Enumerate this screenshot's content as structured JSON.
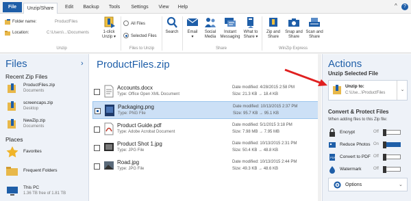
{
  "menubar": {
    "items": [
      "File",
      "Unzip/Share",
      "Edit",
      "Backup",
      "Tools",
      "Settings",
      "View",
      "Help"
    ],
    "collapse": "^",
    "help": "?"
  },
  "ribbon": {
    "unzip": {
      "folder_label": "Folder name:",
      "folder_value": "ProductFiles",
      "location_label": "Location:",
      "location_value": "C:\\Users\\...\\Documents",
      "oneclick": [
        "1-click",
        "Unzip ▾"
      ],
      "group_label": "Unzip"
    },
    "files_to_unzip": {
      "all_files": "All Files",
      "selected_files": "Selected Files",
      "group_label": "Files to Unzip"
    },
    "search": "Search",
    "share": {
      "buttons": [
        [
          "Email",
          "▾"
        ],
        [
          "Social",
          "Media"
        ],
        [
          "Instant",
          "Messaging"
        ],
        [
          "What to",
          "Share ▾"
        ]
      ],
      "group_label": "Share"
    },
    "express": {
      "buttons": [
        [
          "Zip and",
          "Share"
        ],
        [
          "Snap and",
          "Share"
        ],
        [
          "Scan and",
          "Share"
        ]
      ],
      "group_label": "WinZip Express"
    }
  },
  "left": {
    "title": "Files",
    "arrow": "›",
    "recent_title": "Recent Zip Files",
    "recent": [
      {
        "name": "ProductFiles.zip",
        "sub": "Documents"
      },
      {
        "name": "screencaps.zip",
        "sub": "Desktop"
      },
      {
        "name": "NewZip.zip",
        "sub": "Documents"
      }
    ],
    "places_title": "Places",
    "places": [
      {
        "name": "Favorites"
      },
      {
        "name": "Frequent Folders"
      },
      {
        "name": "This PC",
        "sub": "1.36 TB free of 1.81 TB"
      }
    ]
  },
  "main": {
    "title": "ProductFiles.zip",
    "files": [
      {
        "name": "Accounts.docx",
        "type": "Type: Office Open XML Document",
        "date": "Date modified: 4/28/2015 2:58 PM",
        "size": "Size: 21.3 KB  →  18.4 KB",
        "selected": false
      },
      {
        "name": "Packaging.png",
        "type": "Type: PNG File",
        "date": "Date modified: 10/13/2015 2:37 PM",
        "size": "Size: 95.7 KB  →  95.1 KB",
        "selected": true
      },
      {
        "name": "Product Guide.pdf",
        "type": "Type: Adobe Acrobat Document",
        "date": "Date modified: 5/1/2015 3:18 PM",
        "size": "Size: 7.98 MB  →  7.95 MB",
        "selected": false
      },
      {
        "name": "Product Shot 1.jpg",
        "type": "Type: JPG File",
        "date": "Date modified: 10/13/2015 2:31 PM",
        "size": "Size: 50.4 KB  →  48.8 KB",
        "selected": false
      },
      {
        "name": "Road.jpg",
        "type": "Type: JPG File",
        "date": "Date modified: 10/13/2015 2:44 PM",
        "size": "Size: 49.3 KB  →  48.6 KB",
        "selected": false
      }
    ]
  },
  "right": {
    "title": "Actions",
    "unzip_title": "Unzip Selected File",
    "unzip_to": "Unzip to:",
    "unzip_path": "C:\\Use...\\ProductFiles",
    "unzip_dd": "⌄",
    "convert_title": "Convert & Protect Files",
    "hint": "When adding files to this Zip file:",
    "options": [
      {
        "label": "Encrypt",
        "state": "Off",
        "on": false
      },
      {
        "label": "Reduce Photos",
        "state": "On",
        "on": true
      },
      {
        "label": "Convert to PDF",
        "state": "Off",
        "on": false
      },
      {
        "label": "Watermark",
        "state": "Off",
        "on": false
      }
    ],
    "options_btn": "Options",
    "options_dd": "⌄"
  },
  "colors": {
    "accent": "#1e5ea8",
    "selected_row": "#cce0f6",
    "arrow": "#e02020"
  }
}
